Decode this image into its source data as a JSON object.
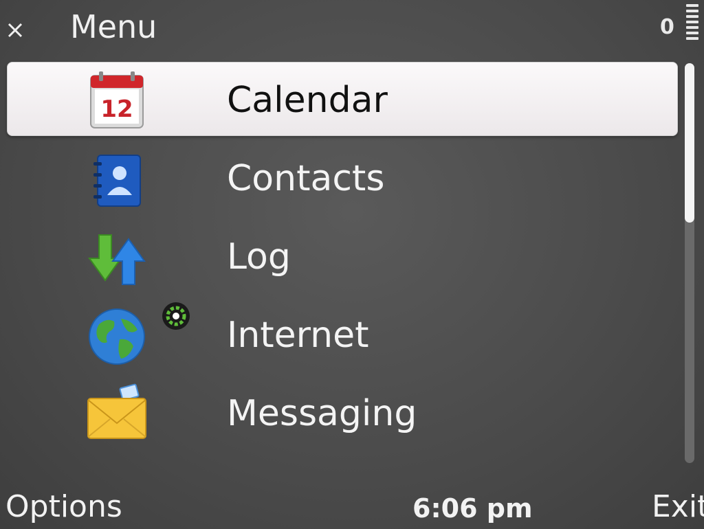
{
  "header": {
    "title": "Menu",
    "signal_count": "0"
  },
  "menu": {
    "items": [
      {
        "label": "Calendar",
        "icon": "calendar-icon",
        "badge": "12",
        "selected": true
      },
      {
        "label": "Contacts",
        "icon": "contacts-icon"
      },
      {
        "label": "Log",
        "icon": "log-icon"
      },
      {
        "label": "Internet",
        "icon": "globe-icon"
      },
      {
        "label": "Messaging",
        "icon": "envelope-icon"
      }
    ]
  },
  "softkeys": {
    "left": "Options",
    "right": "Exit"
  },
  "status": {
    "time": "6:06 pm"
  },
  "colors": {
    "background": "#4a4a4a",
    "highlight": "#f5f3f4",
    "text": "#f2f2f2"
  }
}
